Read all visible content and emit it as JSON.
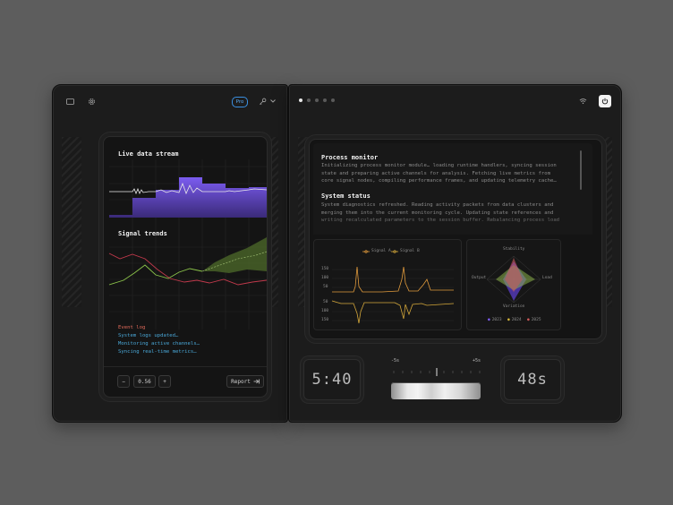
{
  "left_panel": {
    "pro_badge": "Pro",
    "chart1_title": "Live data stream",
    "chart2_title": "Signal trends",
    "event_log": {
      "title": "Event log",
      "items": [
        "System logs updated…",
        "Monitoring active channels…",
        "Syncing real-time metrics…"
      ]
    },
    "stepper": {
      "minus": "−",
      "value": "0.56",
      "plus": "+"
    },
    "report_label": "Report"
  },
  "right_panel": {
    "page_indicator": {
      "count": 5,
      "active": 0
    },
    "process_monitor": {
      "title": "Process monitor",
      "body": "Initializing process monitor module… loading runtime handlers, syncing session state and preparing active channels for analysis. Fetching live metrics from core signal nodes, compiling performance frames, and updating telemetry cache…"
    },
    "system_status": {
      "title": "System status",
      "body": "System diagnostics refreshed. Reading activity packets from data clusters and merging them into the current monitoring cycle. Updating state references and writing recalculated parameters to the session buffer. Rebalancing process load"
    },
    "signal_chart": {
      "legend": [
        "Signal A",
        "Signal B"
      ],
      "y_labels_top": [
        "150",
        "100",
        "50"
      ],
      "y_labels_bottom": [
        "50",
        "100",
        "150"
      ],
      "colors": {
        "signal_a": "#e09a3c",
        "signal_b": "#d4a73a"
      }
    },
    "radar": {
      "axes": {
        "top": "Stability",
        "left": "Output",
        "right": "Load",
        "bottom": "Variation"
      },
      "legend": [
        "2023",
        "2024",
        "2025"
      ],
      "colors": {
        "2023": "#7c5cf0",
        "2024": "#d4b43a",
        "2025": "#d05a5a"
      }
    },
    "time_left": "5:40",
    "slider": {
      "min_label": "-5s",
      "max_label": "+5s"
    },
    "time_right": "48s"
  },
  "colors": {
    "accent_purple": "#7b5cf0",
    "signal_green": "#8bc34a",
    "signal_red": "#c0394b",
    "log_title": "#e06a5a",
    "log_item": "#4aa8d8",
    "pro": "#3a8fe0"
  }
}
